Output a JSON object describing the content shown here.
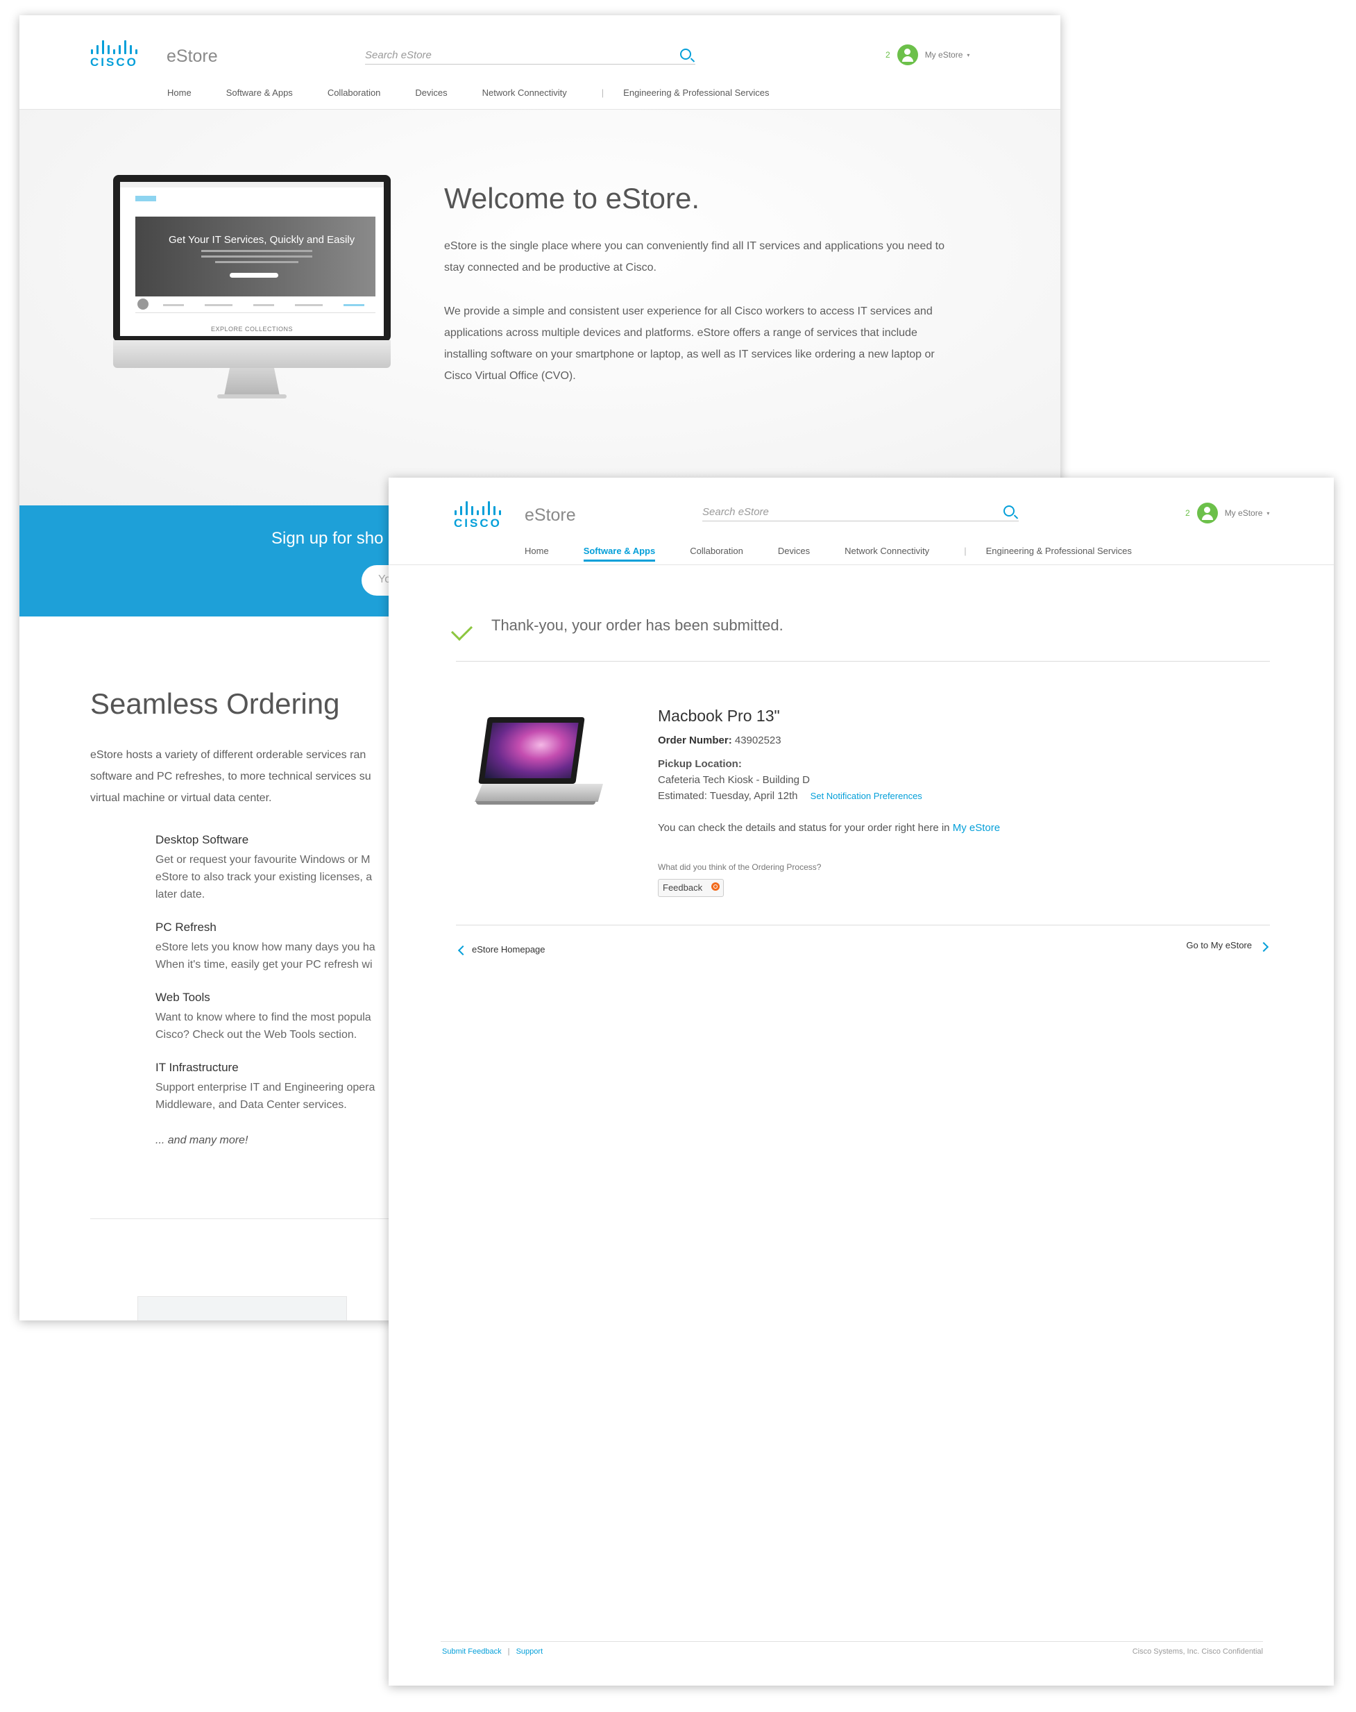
{
  "back_page": {
    "brand": "eStore",
    "logo_text": "CISCO",
    "search_placeholder": "Search eStore",
    "user": {
      "count": "2",
      "label": "My eStore"
    },
    "nav": [
      "Home",
      "Software & Apps",
      "Collaboration",
      "Devices",
      "Network Connectivity",
      "Engineering & Professional Services"
    ],
    "welcome": {
      "title": "Welcome to eStore.",
      "p1_line1": "eStore is the single place where you can conveniently find all IT services and applications you need to",
      "p1_line2": "stay connected  and be productive at Cisco.",
      "p2_line1": "We provide a simple and consistent user experience for all Cisco workers to access IT services and",
      "p2_line2": "applications across multiple devices and platforms. eStore offers a range of services that include",
      "p2_line3": "installing software on your smartphone or laptop, as well as IT services like ordering a new laptop or",
      "p2_line4": "Cisco Virtual Office (CVO)."
    },
    "screenshot": {
      "banner_title": "Get Your IT Services, Quickly and Easily",
      "explore": "EXPLORE COLLECTIONS"
    },
    "signup": {
      "text": "Sign up for sho",
      "input_placeholder": "Yo"
    },
    "seamless": {
      "title": "Seamless Ordering",
      "line1": "eStore hosts a variety of different orderable services ran",
      "line2": "software and PC refreshes, to more technical services su",
      "line3": "virtual machine or virtual data center."
    },
    "features": [
      {
        "title": "Desktop Software",
        "lines": [
          "Get or request your favourite Windows or M",
          "eStore to also track your existing licenses, a",
          "later date."
        ]
      },
      {
        "title": "PC Refresh",
        "lines": [
          "eStore lets you know how many days you ha",
          "When it's time, easily get your PC refresh wi"
        ]
      },
      {
        "title": "Web Tools",
        "lines": [
          "Want to know where to find the most popula",
          "Cisco? Check out the Web Tools section."
        ]
      },
      {
        "title": "IT Infrastructure",
        "lines": [
          "Support enterprise IT and Engineering opera",
          "Middleware, and Data Center services."
        ]
      }
    ],
    "more": "... and many more!"
  },
  "front_page": {
    "brand": "eStore",
    "logo_text": "CISCO",
    "search_placeholder": "Search eStore",
    "user": {
      "count": "2",
      "label": "My eStore"
    },
    "nav": [
      "Home",
      "Software & Apps",
      "Collaboration",
      "Devices",
      "Network Connectivity",
      "Engineering & Professional Services"
    ],
    "active_nav": "Software & Apps",
    "confirmation": "Thank-you, your order has been submitted.",
    "product": {
      "title": "Macbook Pro 13\"",
      "order_label": "Order Number:",
      "order_number": "43902523",
      "pickup_label": "Pickup Location:",
      "pickup_location": "Cafeteria Tech Kiosk - Building D",
      "estimated": "Estimated: Tuesday, April 12th",
      "notif_link": "Set Notification Preferences",
      "status_text": "You can check the details and status for your order right here in",
      "status_link": "My eStore"
    },
    "feedback": {
      "question": "What did you think of the Ordering Process?",
      "button": "Feedback"
    },
    "links": {
      "back": "eStore Homepage",
      "forward": "Go to My eStore"
    },
    "footer": {
      "submit_feedback": "Submit Feedback",
      "divider": "|",
      "support": "Support",
      "copyright": "Cisco Systems, Inc. Cisco Confidential"
    },
    "colors": {
      "accent": "#049fd9",
      "success": "#8cc63f",
      "user": "#6cc04a",
      "feedback": "#f26b1d"
    }
  }
}
